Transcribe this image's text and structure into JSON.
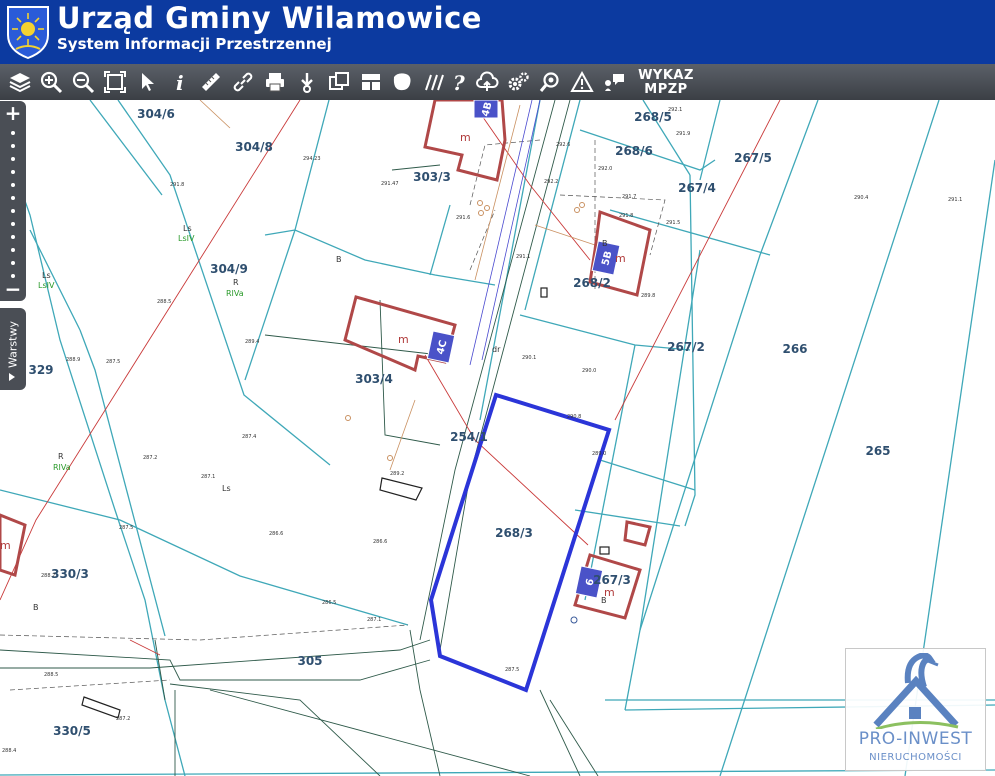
{
  "header": {
    "title": "Urząd Gminy Wilamowice",
    "subtitle": "System Informacji Przestrzennej",
    "background_color": "#0c3aa0"
  },
  "toolbar": {
    "tools": [
      {
        "icon": "layers-icon"
      },
      {
        "icon": "zoom-in-icon"
      },
      {
        "icon": "zoom-out-icon"
      },
      {
        "icon": "zoom-extent-icon"
      },
      {
        "icon": "pointer-icon"
      },
      {
        "icon": "info-icon"
      },
      {
        "icon": "measure-ruler-icon"
      },
      {
        "icon": "link-icon"
      },
      {
        "icon": "print-icon"
      },
      {
        "icon": "download-icon"
      },
      {
        "icon": "copy-icon"
      },
      {
        "icon": "layout-icon"
      },
      {
        "icon": "area-icon"
      },
      {
        "icon": "hatch-icon"
      },
      {
        "icon": "help-icon"
      },
      {
        "icon": "cloud-upload-icon"
      },
      {
        "icon": "settings-icon"
      },
      {
        "icon": "search-icon"
      },
      {
        "icon": "warning-icon"
      },
      {
        "icon": "comment-icon"
      }
    ],
    "wykaz_line1": "WYKAZ",
    "wykaz_line2": "MPZP"
  },
  "zoom": {
    "plus": "+",
    "minus": "−"
  },
  "layers_tab": {
    "label": "Warstwy"
  },
  "map": {
    "selected_color": "#2b35d8",
    "parcel_line_color": "#3fa8b8",
    "building_color": "#b04848",
    "parcels": [
      "304/6",
      "304/8",
      "303/3",
      "268/5",
      "268/6",
      "267/5",
      "267/4",
      "304/9",
      "268/2",
      "329",
      "303/4",
      "267/2",
      "266",
      "254/1",
      "265",
      "268/3",
      "330/3",
      "267/3",
      "305",
      "330/5"
    ],
    "buildings": [
      "4B",
      "5B",
      "4C",
      "6"
    ],
    "land_use": [
      "Ls",
      "LsIV",
      "Ls",
      "LsIV",
      "R",
      "RIVa",
      "R",
      "RIVa",
      "Ls",
      "B",
      "B",
      "B",
      "B",
      "dr"
    ],
    "building_mark": "m",
    "spot_heights": [
      "294.23",
      "291.8",
      "291.47",
      "291.6",
      "290.4",
      "291.1",
      "290.1",
      "290.0",
      "288.5",
      "289.4",
      "288.9",
      "287.5",
      "287.4",
      "287.2",
      "287.1",
      "287.5",
      "286.6",
      "286.6",
      "286.5",
      "288.7",
      "287.1",
      "287.5",
      "288.5",
      "287.2",
      "288.4",
      "289.0",
      "291.5",
      "291.7",
      "291.8",
      "292.1",
      "291.9",
      "292.0",
      "292.6",
      "292.2",
      "289.2",
      "289.8",
      "291.1",
      "290.8"
    ]
  },
  "logo": {
    "line1": "PRO-INWEST",
    "line2": "NIERUCHOMOŚCI"
  }
}
